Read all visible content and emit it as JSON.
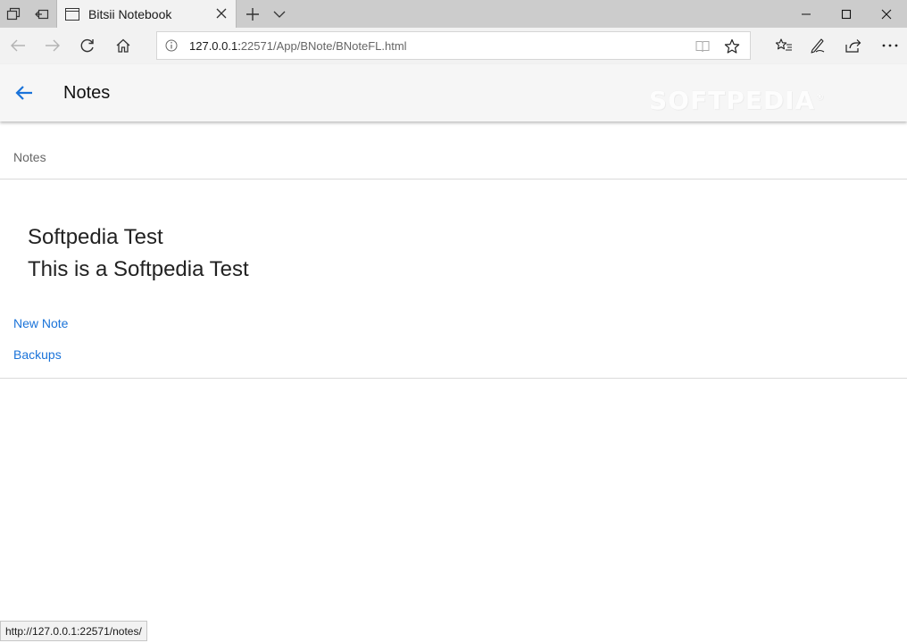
{
  "browser": {
    "tab": {
      "title": "Bitsii Notebook"
    },
    "address": {
      "url_host": "127.0.0.1:",
      "url_rest": "22571/App/BNote/BNoteFL.html"
    },
    "status_url": "http://127.0.0.1:22571/notes/"
  },
  "header": {
    "title": "Notes",
    "watermark": "SOFTPEDIA",
    "watermark_mark": "®"
  },
  "content": {
    "breadcrumb": "Notes",
    "notes": [
      {
        "title": "Softpedia Test"
      },
      {
        "title": "This is a Softpedia Test"
      }
    ],
    "links": {
      "new_note": "New Note",
      "backups": "Backups"
    }
  },
  "colors": {
    "accent": "#1a73d9",
    "titlebar": "#cccccc",
    "toolbar": "#f2f2f2",
    "header": "#f6f6f6"
  },
  "icons": {
    "tab_manager": "tabs-aside-icon",
    "tab_restore": "tabs-restore-icon",
    "page": "page-icon",
    "close": "close-icon",
    "new_tab": "plus-icon",
    "tab_menu": "chevron-down-icon",
    "minimize": "minimize-icon",
    "maximize": "maximize-icon",
    "back": "back-arrow-icon",
    "forward": "forward-arrow-icon",
    "refresh": "refresh-icon",
    "home": "home-icon",
    "info": "info-icon",
    "reading_view": "reading-view-icon",
    "favorite": "star-icon",
    "favorites_hub": "favorites-hub-icon",
    "web_note": "pen-icon",
    "share": "share-icon",
    "more": "more-icon"
  }
}
